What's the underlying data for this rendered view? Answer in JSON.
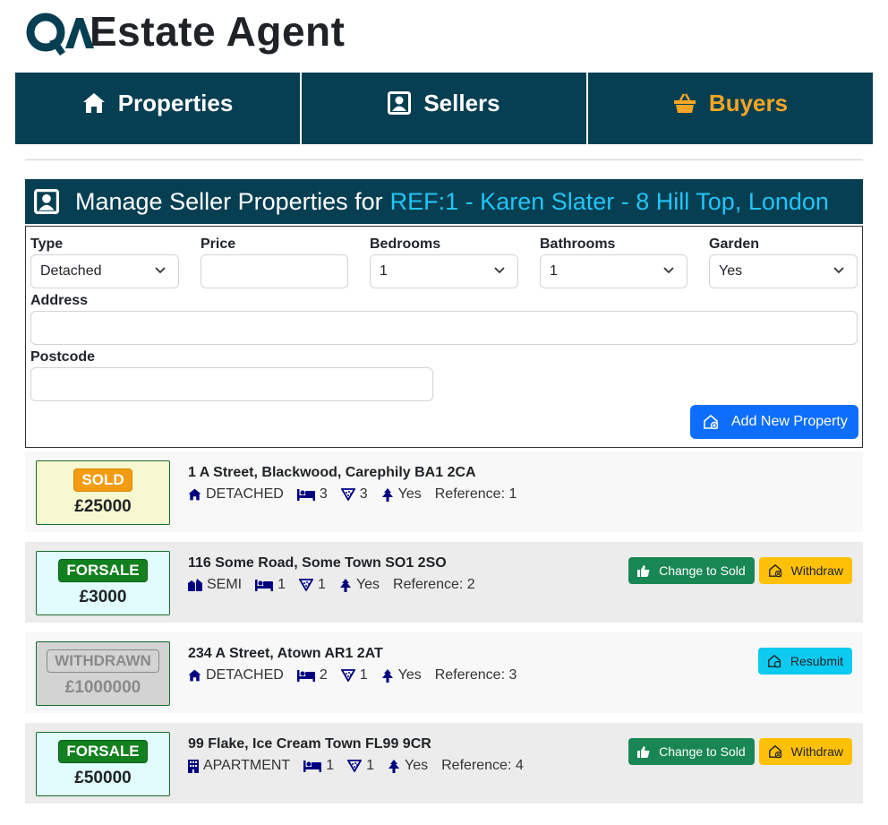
{
  "brand": {
    "title": "Estate Agent",
    "logo_icon": "qa-logo"
  },
  "nav": [
    {
      "label": "Properties",
      "icon": "home-icon"
    },
    {
      "label": "Sellers",
      "icon": "user-box-icon"
    },
    {
      "label": "Buyers",
      "icon": "basket-icon",
      "active": true
    }
  ],
  "panel": {
    "title": "Manage Seller Properties for",
    "seller_ref": "REF:1 - Karen Slater - 8 Hill Top, London"
  },
  "form": {
    "type": {
      "label": "Type",
      "value": "Detached"
    },
    "price": {
      "label": "Price",
      "value": ""
    },
    "bedrooms": {
      "label": "Bedrooms",
      "value": "1"
    },
    "bathrooms": {
      "label": "Bathrooms",
      "value": "1"
    },
    "garden": {
      "label": "Garden",
      "value": "Yes"
    },
    "address": {
      "label": "Address",
      "value": ""
    },
    "postcode": {
      "label": "Postcode",
      "value": ""
    },
    "add_button": "Add New Property"
  },
  "properties": [
    {
      "status": "SOLD",
      "price": "£25000",
      "address": "1  A Street, Blackwood, Carephily BA1 2CA",
      "type": "DETACHED",
      "bedrooms": "3",
      "bathrooms": "3",
      "garden": "Yes",
      "reference": "Reference: 1"
    },
    {
      "status": "FORSALE",
      "price": "£3000",
      "address": "116 Some Road, Some Town SO1 2SO",
      "type": "SEMI",
      "bedrooms": "1",
      "bathrooms": "1",
      "garden": "Yes",
      "reference": "Reference: 2",
      "actions": [
        "Change to Sold",
        "Withdraw"
      ]
    },
    {
      "status": "WITHDRAWN",
      "price": "£1000000",
      "address": "234 A Street, Atown AR1 2AT",
      "type": "DETACHED",
      "bedrooms": "2",
      "bathrooms": "1",
      "garden": "Yes",
      "reference": "Reference: 3",
      "actions": [
        "Resubmit"
      ]
    },
    {
      "status": "FORSALE",
      "price": "£50000",
      "address": "99 Flake, Ice Cream Town FL99 9CR",
      "type": "APARTMENT",
      "bedrooms": "1",
      "bathrooms": "1",
      "garden": "Yes",
      "reference": "Reference: 4",
      "actions": [
        "Change to Sold",
        "Withdraw"
      ]
    }
  ],
  "colors": {
    "nav_bg": "#063e52",
    "nav_active": "#f5a623",
    "seller_ref": "#22c5f5",
    "sold_badge": "#f39c12",
    "forsale_badge": "#13801f",
    "withdrawn_badge": "#d3d3d3",
    "sold_card": "#f8f8d0",
    "forsale_card": "#e0fcfc",
    "withdrawn_card": "#d3d3d3",
    "btn_primary": "#0d6efd",
    "btn_success": "#198754",
    "btn_warning": "#ffc107",
    "btn_info": "#0dcaf0",
    "icon_navy": "#000080"
  }
}
